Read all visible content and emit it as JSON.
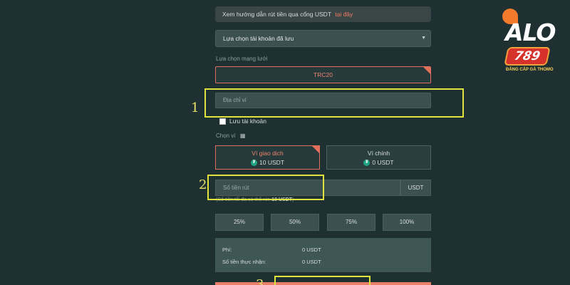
{
  "notice": {
    "text": "Xem hướng dẫn rút tiền qua cổng USDT",
    "link": "tại đây"
  },
  "saved_account_select": {
    "value": "Lựa chọn tài khoản đã lưu"
  },
  "network": {
    "label": "Lựa chọn mạng lưới",
    "value": "TRC20"
  },
  "address": {
    "placeholder": "Địa chỉ ví"
  },
  "save_account": {
    "label": "Lưu tài khoản",
    "checked": false
  },
  "wallet_section": {
    "label": "Chọn ví",
    "wallets": [
      {
        "name": "Ví giao dịch",
        "value": "10 USDT",
        "selected": true
      },
      {
        "name": "Ví chính",
        "value": "0 USDT",
        "selected": false
      }
    ]
  },
  "amount": {
    "placeholder": "Số tiền rút",
    "unit": "USDT",
    "available_prefix": "(Số tiền tối đa có thể rút: ",
    "available_value": "10 USDT",
    "available_suffix": ")"
  },
  "percent_buttons": [
    "25%",
    "50%",
    "75%",
    "100%"
  ],
  "summary": {
    "fee_label": "Phí:",
    "fee_value": "0 USDT",
    "receive_label": "Số tiền thực nhận:",
    "receive_value": "0 USDT"
  },
  "annotations": [
    "1",
    "2",
    "3"
  ],
  "logo": {
    "brand": "ALO",
    "number": "789",
    "tagline": "ĐẲNG CẤP GÀ THOMO"
  },
  "colors": {
    "accent": "#e26f5b",
    "highlight": "#dfe33a",
    "background": "#1f3032",
    "usdt": "#1ea484"
  }
}
